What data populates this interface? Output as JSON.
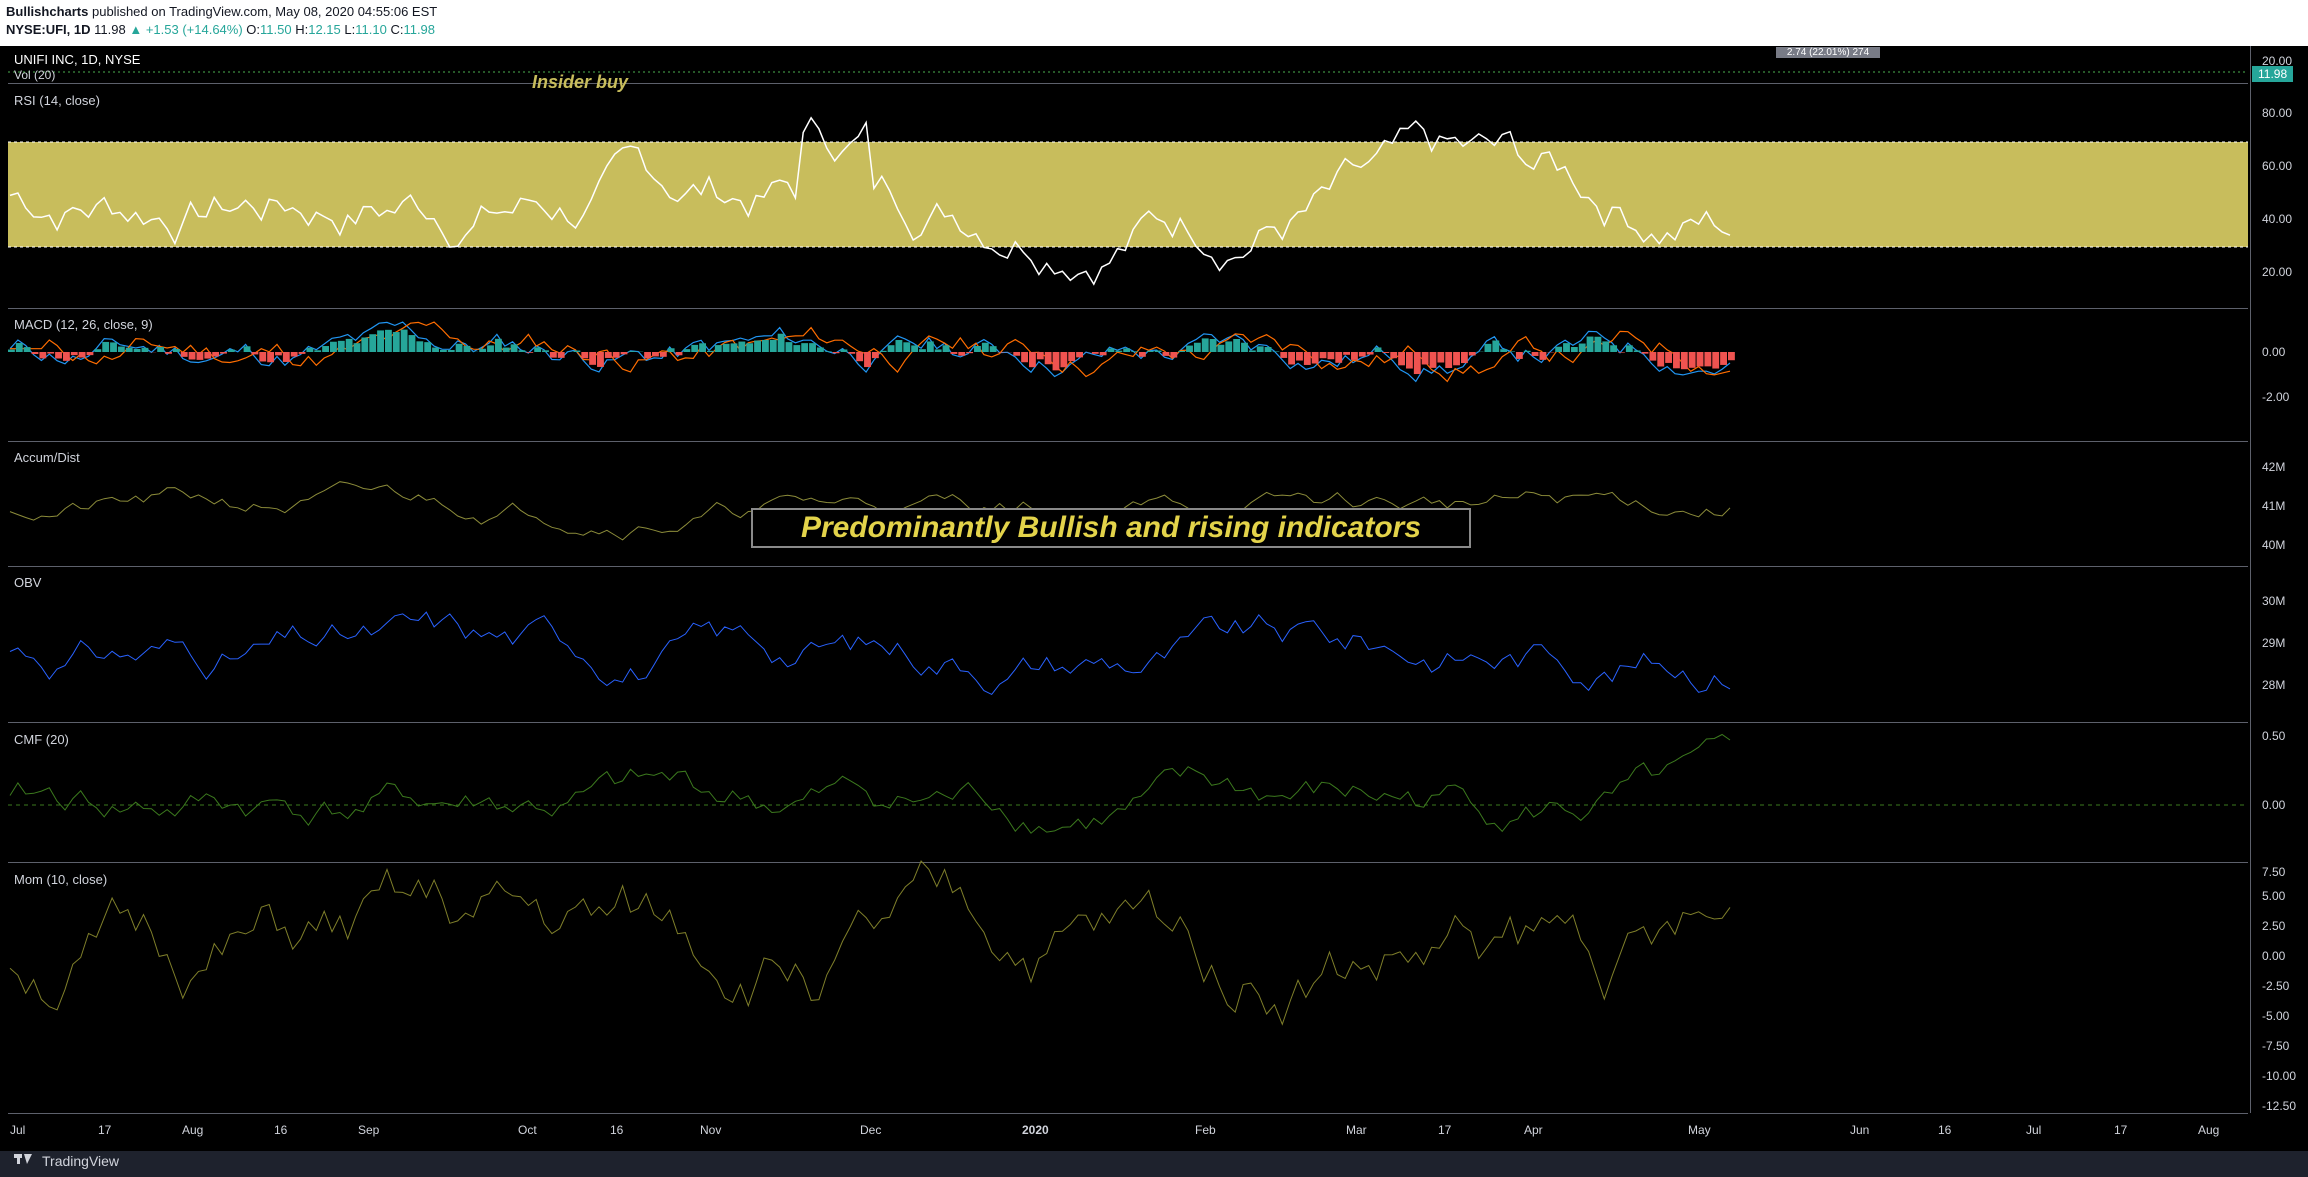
{
  "header": {
    "publisher": "Bullishcharts",
    "published_text": "published on TradingView.com, May 08, 2020 04:55:06 EST",
    "symbol": "NYSE:UFI, 1D",
    "last": "11.98",
    "change": "▲ +1.53 (+14.64%)",
    "o_label": "O:",
    "o_val": "11.50",
    "h_label": "H:",
    "h_val": "12.15",
    "l_label": "L:",
    "l_val": "11.10",
    "c_label": "C:",
    "c_val": "11.98"
  },
  "price_pane": {
    "title": "UNIFI INC, 1D, NYSE",
    "volume_label": "Vol (20)",
    "insider_text": "Insider buy",
    "range_label": "2.74 (22.01%) 274",
    "price_tag": "11.98",
    "axis_top": "20.00"
  },
  "panes": {
    "rsi": {
      "label": "RSI (14, close)",
      "ticks": [
        "80.00",
        "60.00",
        "40.00",
        "20.00"
      ]
    },
    "macd": {
      "label": "MACD (12, 26, close, 9)",
      "ticks": [
        "0.00",
        "-2.00"
      ]
    },
    "ad": {
      "label": "Accum/Dist",
      "ticks": [
        "42M",
        "41M",
        "40M"
      ]
    },
    "obv": {
      "label": "OBV",
      "ticks": [
        "30M",
        "29M",
        "28M"
      ]
    },
    "cmf": {
      "label": "CMF (20)",
      "ticks": [
        "0.50",
        "0.00"
      ]
    },
    "mom": {
      "label": "Mom (10, close)",
      "ticks": [
        "5.00",
        "2.50",
        "0.00",
        "-2.50",
        "-5.00",
        "-7.50",
        "-10.00",
        "-12.50",
        "7.50"
      ]
    }
  },
  "annotation": "Predominantly  Bullish  and rising indicators",
  "x_axis": [
    "Jul",
    "17",
    "Aug",
    "16",
    "Sep",
    "Oct",
    "16",
    "Nov",
    "Dec",
    "2020",
    "Feb",
    "Mar",
    "17",
    "Apr",
    "May",
    "Jun",
    "16",
    "Jul",
    "17",
    "Aug"
  ],
  "footer": {
    "brand": "TradingView"
  },
  "colors": {
    "rsi_band": "#c8bd5c",
    "macd_line": "#2196f3",
    "signal_line": "#ff6d00",
    "hist_up": "#26a69a",
    "hist_down": "#ef5350",
    "ad_line": "#8c8c3a",
    "obv_line": "#2962ff",
    "cmf_line": "#3c7a1e",
    "mom_line": "#7f7f2a"
  }
}
